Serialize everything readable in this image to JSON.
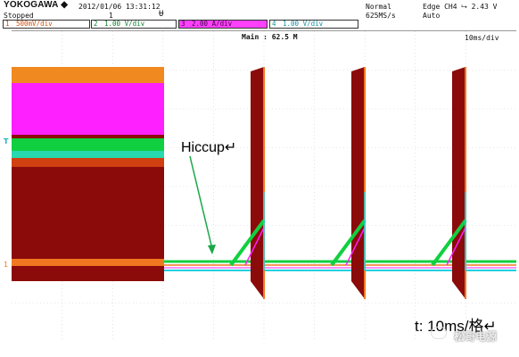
{
  "header": {
    "brand": "YOKOGAWA ◆",
    "datetime": "2012/01/06 13:31:12",
    "state": "Stopped",
    "acq_count": "1",
    "acq_mode": "Normal",
    "sample_rate": "625MS/s",
    "trigger": "Edge CH4 ⮡ 2.43 V",
    "trigger_mode": "Auto"
  },
  "channels": [
    {
      "num": "1",
      "scale": "500mV/div",
      "color": "#f07820"
    },
    {
      "num": "2",
      "scale": "1.00 V/div",
      "color": "#10d040"
    },
    {
      "num": "3",
      "scale": "2.00 A/div",
      "color": "#ff20ff"
    },
    {
      "num": "4",
      "scale": "1.00 V/div",
      "color": "#20d0e0"
    }
  ],
  "display": {
    "main_samples": "Main : 62.5 M",
    "timebase": "10ms/div",
    "trigger_marker": "T",
    "ground_marker": "1"
  },
  "annotations": {
    "hiccup": "Hiccup↵",
    "time_note": "t: 10ms/格↵",
    "watermark": "松哥电源"
  },
  "colors": {
    "ch1": "#f07820",
    "ch2": "#10d040",
    "ch3": "#ff20ff",
    "ch4": "#20d0e0",
    "burst": "#8b0000",
    "annotation_arrow": "#18a848"
  }
}
